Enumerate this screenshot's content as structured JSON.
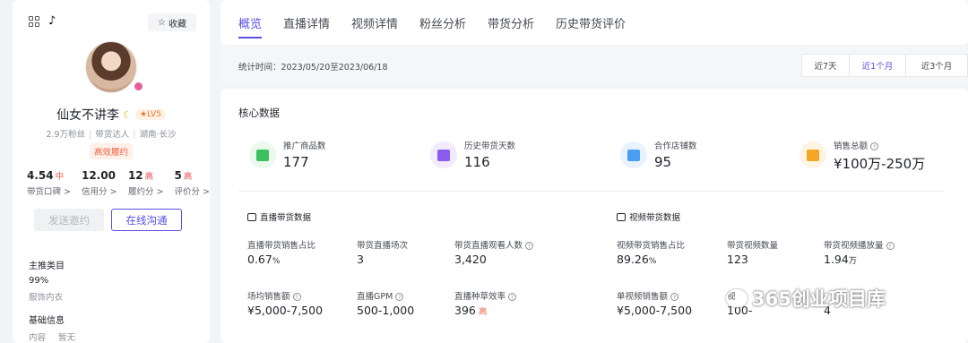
{
  "profile": {
    "favorite_label": "收藏",
    "name": "仙女不讲李",
    "level": "LV5",
    "followers": "2.9万粉丝",
    "role": "带货达人",
    "location": "湖南·长沙",
    "tag": "高效履约",
    "scores": [
      {
        "value": "4.54",
        "grade": "中",
        "grade_color": "#f2603d",
        "label": "带货口碑 >"
      },
      {
        "value": "12.00",
        "grade": "",
        "grade_color": "#f2603d",
        "label": "信用分 >"
      },
      {
        "value": "12",
        "grade": "高",
        "grade_color": "#e5484d",
        "label": "履约分 >"
      },
      {
        "value": "5",
        "grade": "高",
        "grade_color": "#e5484d",
        "label": "评价分 >"
      }
    ],
    "invite_button": "发送邀约",
    "chat_button": "在线沟通",
    "main_category_title": "主推类目",
    "main_category_percent": "99%",
    "main_category_name": "服饰内衣",
    "basic_info_title": "基础信息",
    "basic_info_key": "内容",
    "basic_info_value": "暂无"
  },
  "tabs": [
    "概览",
    "直播详情",
    "视频详情",
    "粉丝分析",
    "带货分析",
    "历史带货评价"
  ],
  "active_tab": "概览",
  "stat_time": "统计时间：2023/05/20至2023/06/18",
  "periods": [
    "近7天",
    "近1个月",
    "近3个月"
  ],
  "active_period": "近1个月",
  "core": {
    "title": "核心数据",
    "metrics": [
      {
        "label": "推广商品数",
        "value": "177",
        "icon": "product-icon",
        "color": "#3cbf5c",
        "bg": "#eaf8ee"
      },
      {
        "label": "历史带货天数",
        "value": "116",
        "icon": "calendar-icon",
        "color": "#8a5cf0",
        "bg": "#f1ebfd"
      },
      {
        "label": "合作店铺数",
        "value": "95",
        "icon": "shop-icon",
        "color": "#4a9cf5",
        "bg": "#e9f3fe"
      },
      {
        "label": "销售总额",
        "value": "¥100万-250万",
        "icon": "money-icon",
        "color": "#f5a623",
        "bg": "#fef4e4"
      }
    ]
  },
  "live": {
    "title": "直播带货数据",
    "items": [
      {
        "label": "直播带货销售占比",
        "value": "0.67",
        "unit": "%",
        "tag": "",
        "help": false
      },
      {
        "label": "带货直播场次",
        "value": "3",
        "unit": "",
        "tag": "",
        "help": false
      },
      {
        "label": "带货直播观看人数",
        "value": "3,420",
        "unit": "",
        "tag": "",
        "help": true
      },
      {
        "label": "场均销售额",
        "value": "¥5,000-7,500",
        "unit": "",
        "tag": "",
        "help": true
      },
      {
        "label": "直播GPM",
        "value": "500-1,000",
        "unit": "",
        "tag": "",
        "help": true
      },
      {
        "label": "直播种草效率",
        "value": "396",
        "unit": "",
        "tag": "高",
        "help": true
      }
    ]
  },
  "video": {
    "title": "视频带货数据",
    "items": [
      {
        "label": "视频带货销售占比",
        "value": "89.26",
        "unit": "%",
        "tag": "",
        "help": false
      },
      {
        "label": "带货视频数量",
        "value": "123",
        "unit": "",
        "tag": "",
        "help": false
      },
      {
        "label": "带货视频播放量",
        "value": "1.94",
        "unit": "万",
        "tag": "",
        "help": true
      },
      {
        "label": "单视频销售额",
        "value": "¥5,000-7,500",
        "unit": "",
        "tag": "",
        "help": true
      },
      {
        "label": "视",
        "value": "100-",
        "unit": "",
        "tag": "",
        "help": false
      },
      {
        "label": "",
        "value": "4",
        "unit": "",
        "tag": "",
        "help": false
      }
    ]
  },
  "watermark": "365创业项目库"
}
